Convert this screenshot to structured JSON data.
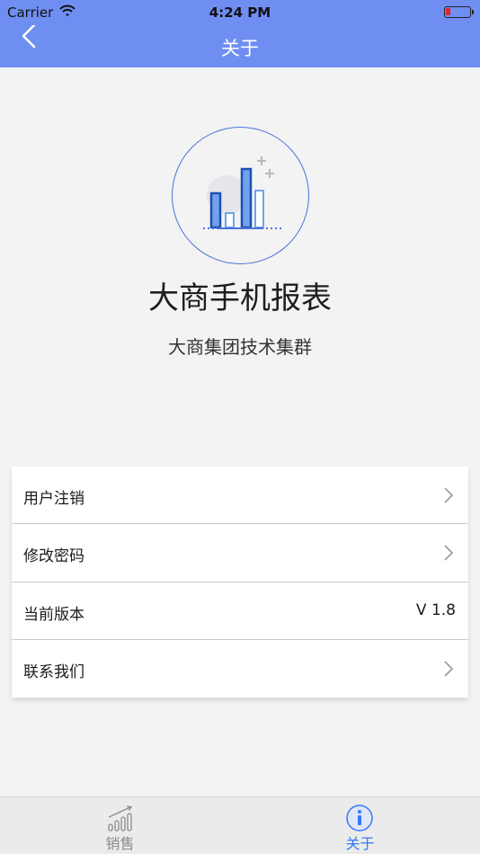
{
  "status_bar": {
    "carrier": "Carrier",
    "time": "4:24 PM",
    "wifi_icon": "wifi-icon",
    "battery_icon": "battery-icon"
  },
  "nav": {
    "title": "关于",
    "back_icon": "chevron-left-icon"
  },
  "about": {
    "logo_icon": "bar-chart-logo-icon",
    "app_name": "大商手机报表",
    "subtitle": "大商集团技术集群"
  },
  "menu": {
    "items": [
      {
        "label": "用户注销",
        "chevron": true
      },
      {
        "label": "修改密码",
        "chevron": true
      },
      {
        "label": "当前版本",
        "value": "V 1.8"
      },
      {
        "label": "联系我们",
        "chevron": true
      }
    ]
  },
  "tabs": [
    {
      "label": "销售",
      "icon": "sales-chart-icon",
      "active": false
    },
    {
      "label": "关于",
      "icon": "info-icon",
      "active": true
    }
  ],
  "colors": {
    "nav_bar": "#6f8ef2",
    "accent": "#3478f6",
    "tab_inactive": "#8a8a8a",
    "background": "#f3f3f3"
  }
}
